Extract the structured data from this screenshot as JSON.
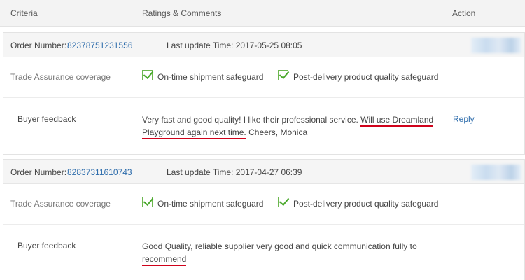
{
  "header": {
    "criteria": "Criteria",
    "ratings": "Ratings & Comments",
    "action": "Action"
  },
  "orders": [
    {
      "order_number_label": "Order Number:",
      "order_number": "82378751231556",
      "last_update": "Last update Time: 2017-05-25 08:05",
      "trade_assurance_label": "Trade Assurance coverage",
      "safeguards": [
        "On-time shipment safeguard",
        "Post-delivery product quality safeguard"
      ],
      "feedback_label": "Buyer feedback",
      "feedback_part1": "Very fast and good quality! I like their professional service. ",
      "feedback_underlined": "Will use Dreamland Playground again next time.",
      "feedback_part2": " Cheers, Monica",
      "reply": "Reply"
    },
    {
      "order_number_label": "Order Number:",
      "order_number": "82837311610743",
      "last_update": "Last update Time: 2017-04-27 06:39",
      "trade_assurance_label": "Trade Assurance coverage",
      "safeguards": [
        "On-time shipment safeguard",
        "Post-delivery product quality safeguard"
      ],
      "feedback_label": "Buyer feedback",
      "feedback_part1": "Good Quality, reliable supplier very good and quick communication fully to ",
      "feedback_underlined": "recommend",
      "feedback_part2": "",
      "reply": ""
    }
  ],
  "colors": {
    "link": "#2e6dac",
    "underline": "#d0021b",
    "check": "#49a82b"
  }
}
